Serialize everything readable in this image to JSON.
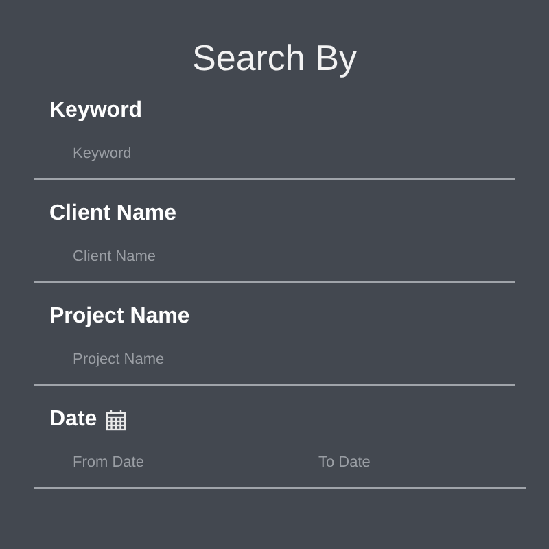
{
  "title": "Search By",
  "sections": [
    {
      "kind": "text",
      "label": "Keyword",
      "fields": [
        {
          "placeholder": "Keyword"
        }
      ]
    },
    {
      "kind": "text",
      "label": "Client Name",
      "fields": [
        {
          "placeholder": "Client Name"
        }
      ]
    },
    {
      "kind": "text",
      "label": "Project Name",
      "fields": [
        {
          "placeholder": "Project Name"
        }
      ]
    },
    {
      "kind": "date",
      "label": "Date",
      "fields": [
        {
          "placeholder": "From Date"
        },
        {
          "placeholder": "To Date"
        }
      ]
    }
  ]
}
